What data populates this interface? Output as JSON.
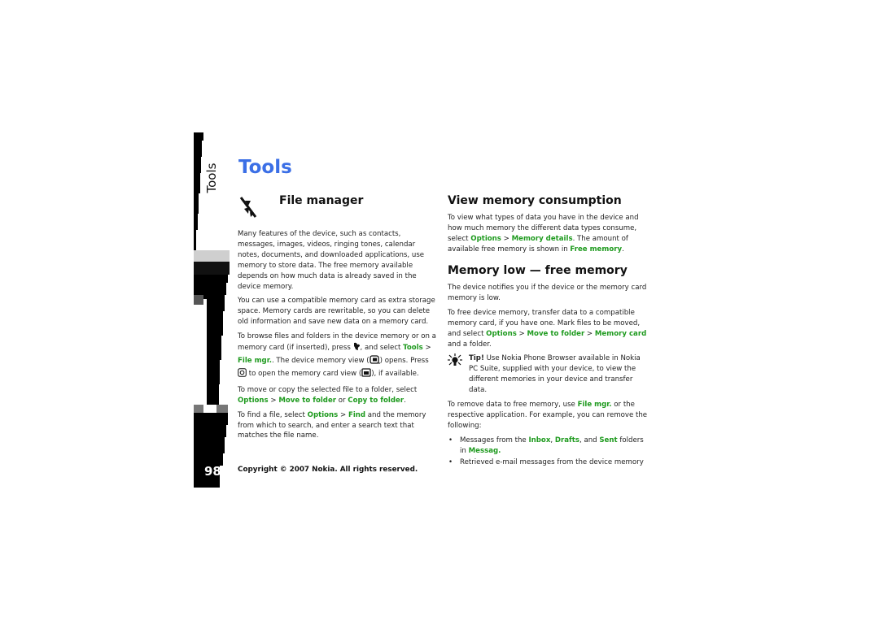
{
  "side_tab": {
    "label": "Tools",
    "page_number": "98"
  },
  "title": "Tools",
  "file_manager": {
    "heading": "File manager",
    "icon": "file-manager-icon",
    "p1": "Many features of the device, such as contacts, messages, images, videos, ringing tones, calendar notes, documents, and downloaded applications, use memory to store data. The free memory available depends on how much data is already saved in the device memory.",
    "p2": "You can use a compatible memory card as extra storage space. Memory cards are rewritable, so you can delete old information and save new data on a memory card.",
    "p3": {
      "t1": "To browse files and folders in the device memory or on a memory card (if inserted), press ",
      "t2": ", and select ",
      "l1": "Tools",
      "sep": " > ",
      "l2": "File mgr.",
      "t3": ". The device memory view (",
      "t4": ") opens. Press ",
      "t5": " to open the memory card view (",
      "t6": "), if available."
    },
    "p4": {
      "t1": "To move or copy the selected file to a folder, select ",
      "l1": "Options",
      "sep": " > ",
      "l2": "Move to folder",
      "t2": " or ",
      "l3": "Copy to folder",
      "t3": "."
    },
    "p5": {
      "t1": "To find a file, select ",
      "l1": "Options",
      "sep": " > ",
      "l2": "Find",
      "t2": " and the memory from which to search, and enter a search text that matches the file name."
    }
  },
  "view_memory": {
    "heading": "View memory consumption",
    "t1": "To view what types of data you have in the device and how much memory the different data types consume, select ",
    "l1": "Options",
    "sep": " > ",
    "l2": "Memory details",
    "t2": ". The amount of available free memory is shown in ",
    "l3": "Free memory",
    "t3": "."
  },
  "memory_low": {
    "heading": "Memory low — free memory",
    "p1": "The device notifies you if the device or the memory card memory is low.",
    "p2": {
      "t1": "To free device memory, transfer data to a compatible memory card, if you have one. Mark files to be moved, and select ",
      "l1": "Options",
      "sep1": " > ",
      "l2": "Move to folder",
      "sep2": " > ",
      "l3": "Memory card",
      "t2": " and a folder."
    },
    "tip": {
      "label": "Tip!",
      "text": " Use Nokia Phone Browser available in Nokia PC Suite, supplied with your device, to view the different memories in your device and transfer data."
    },
    "p3": {
      "t1": "To remove data to free memory, use ",
      "l1": "File mgr.",
      "t2": " or the respective application. For example, you can remove the following:"
    },
    "bullets": {
      "b1": {
        "t1": "Messages from the ",
        "l1": "Inbox",
        "c1": ", ",
        "l2": "Drafts",
        "c2": ", and ",
        "l3": "Sent",
        "t2": " folders in ",
        "l4": "Messag."
      },
      "b2": {
        "t1": "Retrieved e-mail messages from the device memory"
      }
    }
  },
  "footer": {
    "copyright": "Copyright © 2007 Nokia. All rights reserved."
  },
  "colors": {
    "title": "#3b6fe6",
    "link": "#1e9a1e",
    "text": "#222222"
  }
}
